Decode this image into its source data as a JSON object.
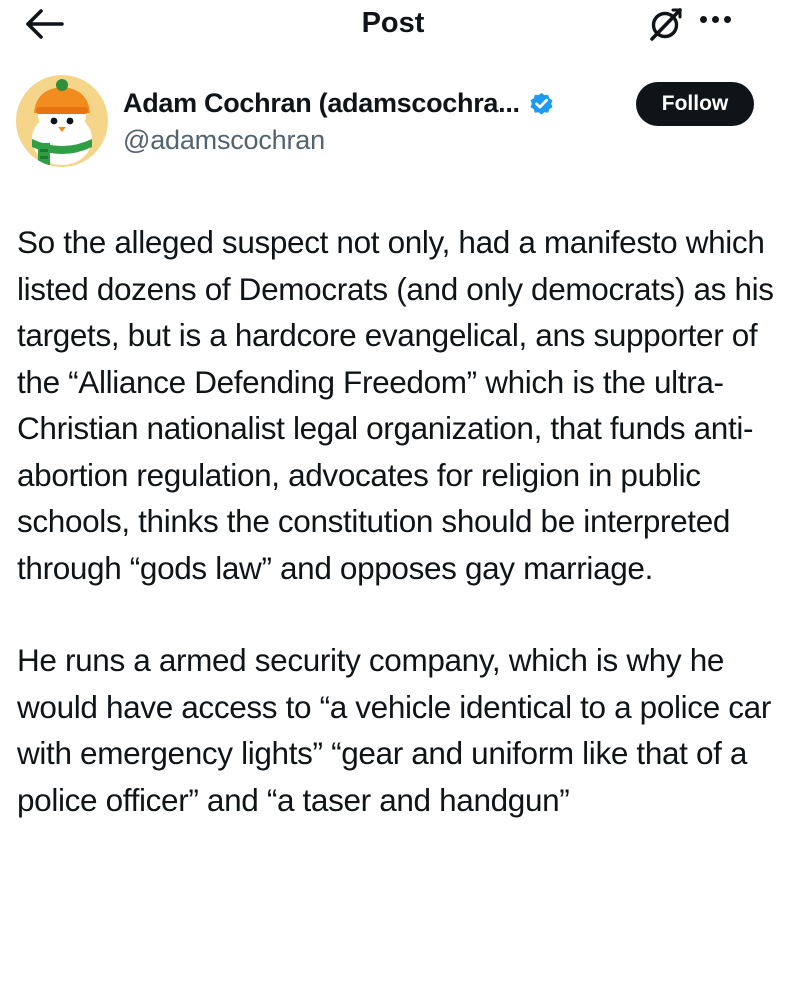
{
  "header": {
    "title": "Post",
    "back_icon": "arrow-left-icon",
    "grok_icon": "grok-icon",
    "more_icon": "more-horizontal-icon"
  },
  "author": {
    "display_name": "Adam Cochran (adamscochra...",
    "handle": "@adamscochran",
    "verified": true,
    "verified_color": "#1d9bf0",
    "avatar_icon": "penguin-avatar",
    "follow_label": "Follow"
  },
  "post": {
    "paragraphs": [
      "So the alleged suspect not only, had a manifesto which listed dozens of Democrats (and only democrats) as his targets, but is a hardcore evangelical, ans supporter of the “Alliance Defending Freedom” which is the ultra-Christian nationalist legal organization, that funds anti-abortion regulation, advocates for religion in public schools, thinks the constitution should be interpreted through “gods law” and opposes gay marriage.",
      "He runs a armed security company, which is why he would have access to “a vehicle identical to a police car with emergency lights” “gear and uniform like that of a police officer” and “a taser and handgun”"
    ]
  },
  "colors": {
    "text": "#0f1419",
    "secondary_text": "#536471",
    "follow_button_bg": "#0f1419",
    "follow_button_text": "#ffffff"
  }
}
